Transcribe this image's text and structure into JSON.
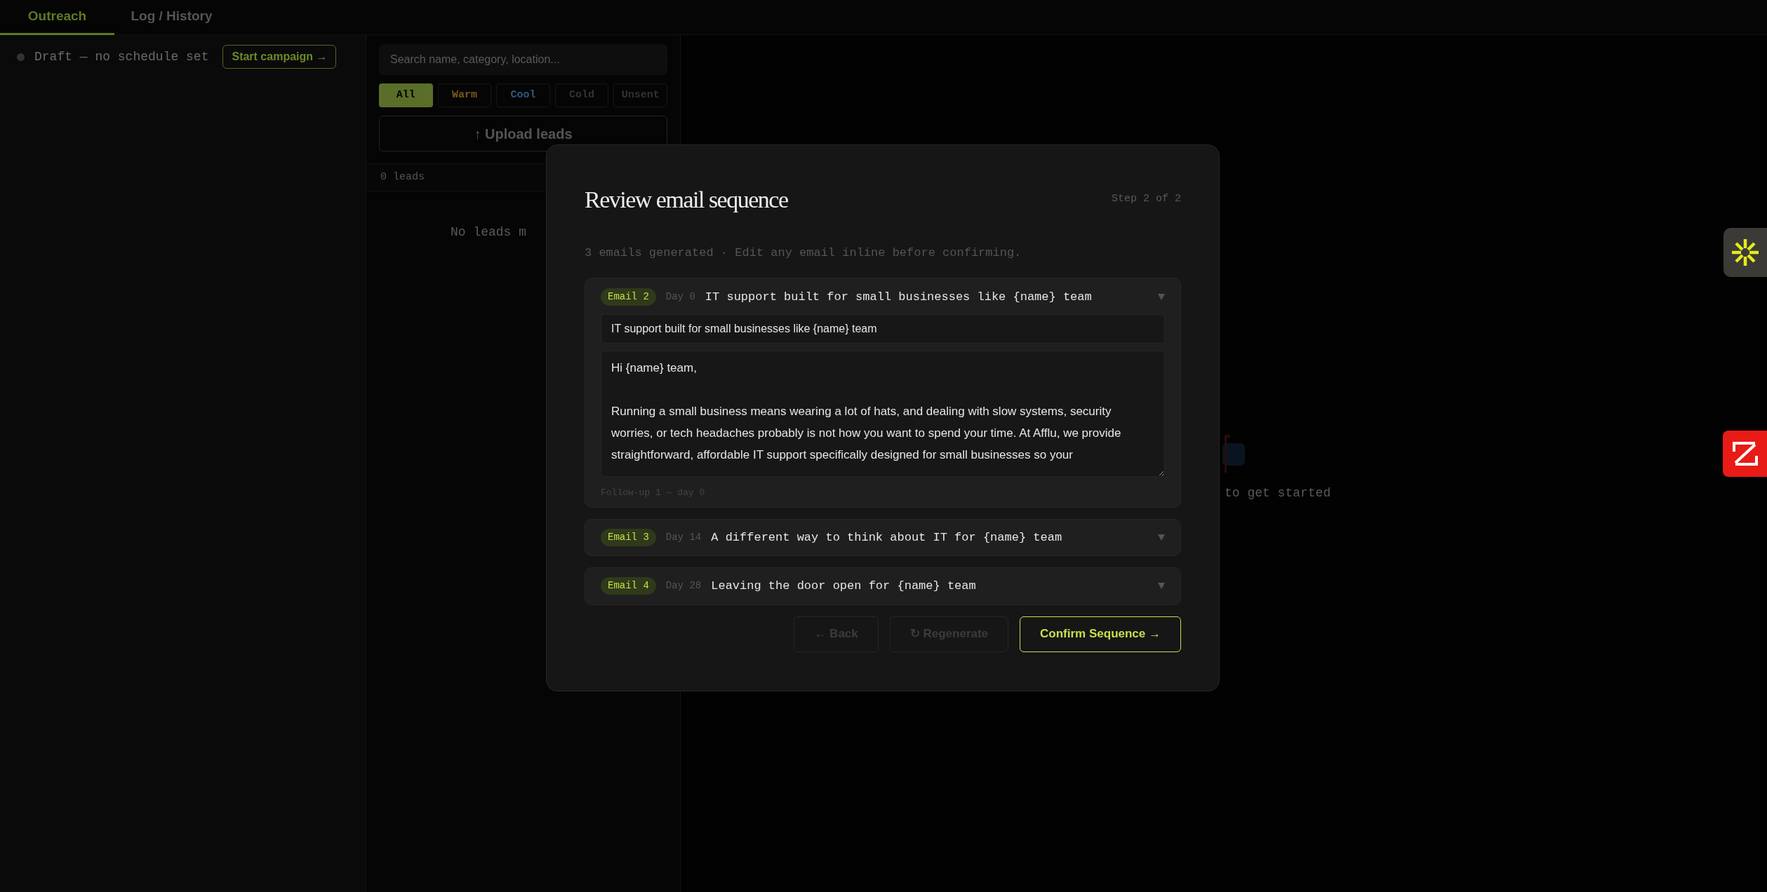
{
  "tabs": [
    {
      "label": "Outreach",
      "selected": true
    },
    {
      "label": "Log / History",
      "selected": false
    }
  ],
  "campaign": {
    "status": "Draft — no schedule set",
    "action": "Start campaign →"
  },
  "leads_panel": {
    "search": {
      "placeholder": "Search name, category, location..."
    },
    "filters": [
      {
        "label": "All",
        "selected": true,
        "color": "#5a6e2a"
      },
      {
        "label": "Warm",
        "selected": false,
        "color": "#7a5a1e"
      },
      {
        "label": "Cool",
        "selected": false,
        "color": "#2e5a82"
      },
      {
        "label": "Cold",
        "selected": false,
        "color": "#333333"
      },
      {
        "label": "Unsent",
        "selected": false,
        "color": "#333333"
      }
    ],
    "upload": "↑ Upload leads",
    "count": "0 leads",
    "empty": "No leads m"
  },
  "main": {
    "empty_hint": "to get started"
  },
  "modal": {
    "title": "Review email sequence",
    "step": "Step 2 of 2",
    "subtitle": "3 emails generated · Edit any email inline before confirming.",
    "emails": [
      {
        "badge": "Email 2",
        "day": "Day 0",
        "subject": "IT support built for small businesses like {name} team",
        "expanded": true,
        "subject_value": "IT support built for small businesses like {name} team",
        "body_value": "Hi {name} team,\n\nRunning a small business means wearing a lot of hats, and dealing with slow systems, security worries, or tech headaches probably is not how you want to spend your time. At Afflu, we provide straightforward, affordable IT support specifically designed for small businesses so your",
        "footer": "Follow-up 1 — day 0"
      },
      {
        "badge": "Email 3",
        "day": "Day 14",
        "subject": "A different way to think about IT for {name} team",
        "expanded": false
      },
      {
        "badge": "Email 4",
        "day": "Day 28",
        "subject": "Leaving the door open for {name} team",
        "expanded": false
      }
    ],
    "buttons": [
      {
        "label": "← Back",
        "kind": "muted"
      },
      {
        "label": "↻ Regenerate",
        "kind": "muted"
      },
      {
        "label": "Confirm Sequence →",
        "kind": "primary"
      }
    ]
  }
}
